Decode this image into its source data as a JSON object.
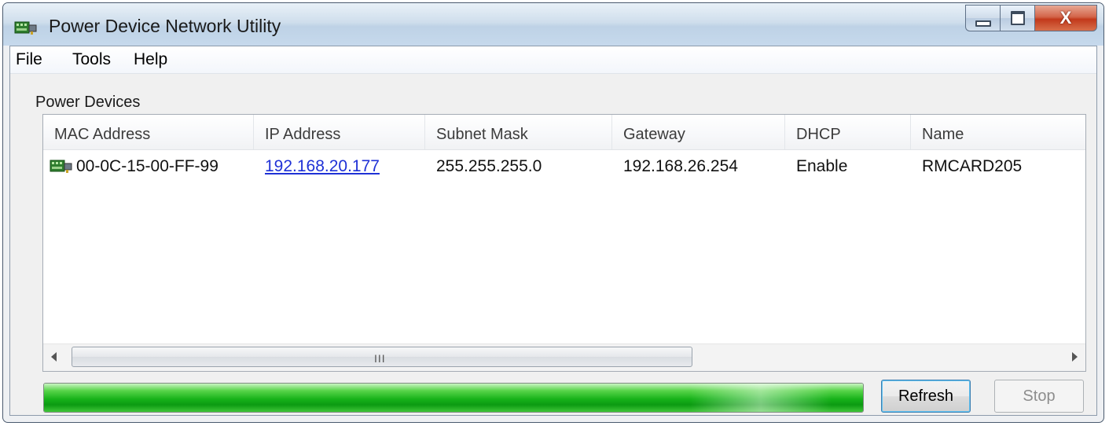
{
  "window": {
    "title": "Power Device Network Utility",
    "icon": "network-card-icon",
    "controls": {
      "minimize": "minimize-icon",
      "maximize": "maximize-icon",
      "close": "X"
    }
  },
  "menu": {
    "file": "File",
    "tools": "Tools",
    "help": "Help"
  },
  "section_label": "Power Devices",
  "table": {
    "columns": [
      "MAC Address",
      "IP Address",
      "Subnet Mask",
      "Gateway",
      "DHCP",
      "Name"
    ],
    "rows": [
      {
        "mac": "00-0C-15-00-FF-99",
        "ip": "192.168.20.177",
        "subnet": "255.255.255.0",
        "gateway": "192.168.26.254",
        "dhcp": "Enable",
        "name": "RMCARD205"
      }
    ],
    "scrollbar_grip": "III"
  },
  "progress": {
    "value": 1.0,
    "color": "#17b21a"
  },
  "buttons": {
    "refresh": "Refresh",
    "stop": "Stop"
  },
  "colors": {
    "link": "#1f31d6",
    "titlebar": "#cfdeec",
    "close_button": "#c2391b"
  }
}
